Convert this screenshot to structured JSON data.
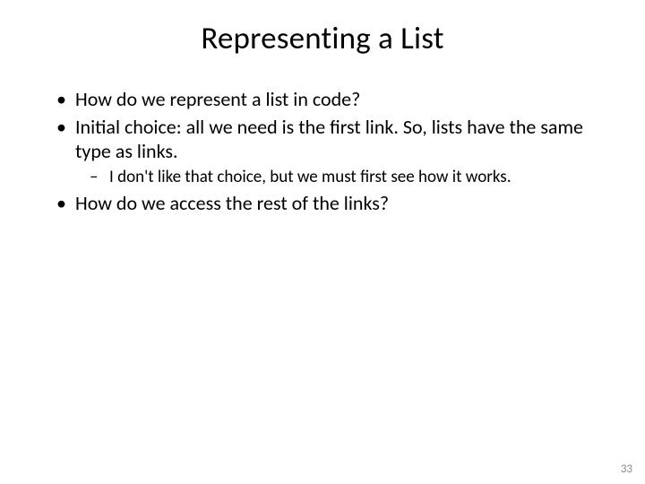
{
  "slide": {
    "title": "Representing a List",
    "bullets": {
      "b1": "How do we represent a list in code?",
      "b2": "Initial choice: all we need is the first link. So, lists have the same type as links.",
      "b2_sub1": "I don't like that choice, but we must first see how it works.",
      "b3": "How do we access the rest of the links?"
    },
    "page_number": "33"
  }
}
